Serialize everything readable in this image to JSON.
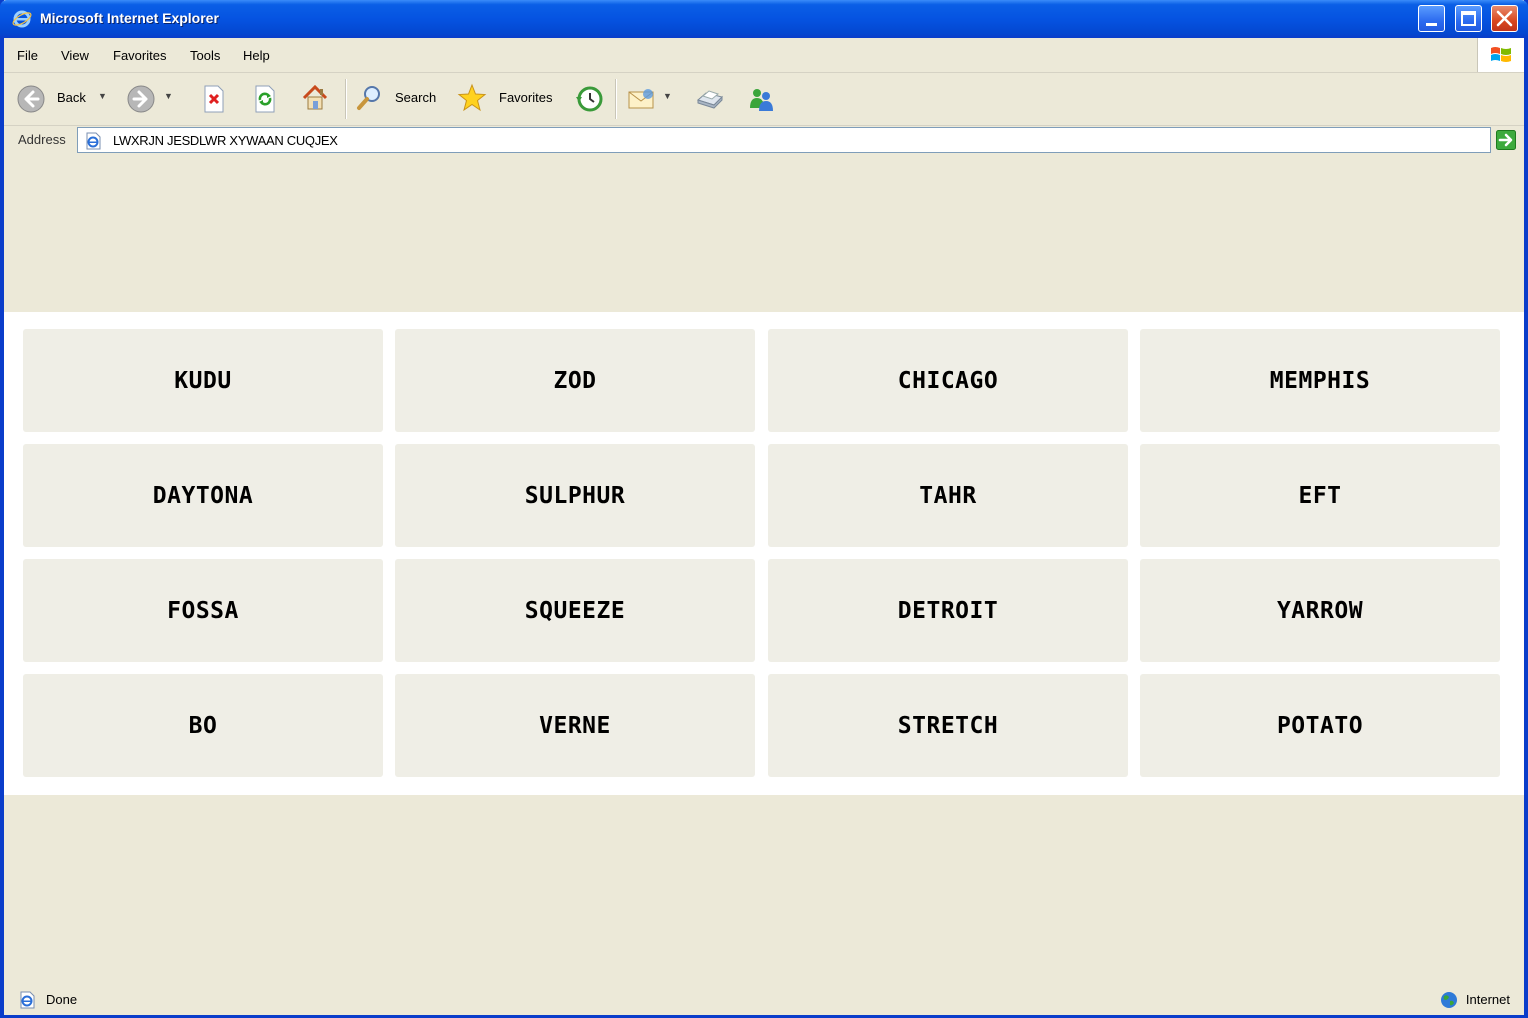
{
  "window": {
    "title": "Microsoft Internet Explorer"
  },
  "menu": {
    "items": [
      "File",
      "View",
      "Favorites",
      "Tools",
      "Help"
    ]
  },
  "toolbar": {
    "back_label": "Back",
    "search_label": "Search",
    "favorites_label": "Favorites"
  },
  "address": {
    "label": "Address",
    "value": "LWXRJN JESDLWR XYWAAN CUQJEX"
  },
  "grid": {
    "words": [
      "KUDU",
      "ZOD",
      "CHICAGO",
      "MEMPHIS",
      "DAYTONA",
      "SULPHUR",
      "TAHR",
      "EFT",
      "FOSSA",
      "SQUEEZE",
      "DETROIT",
      "YARROW",
      "BO",
      "VERNE",
      "STRETCH",
      "POTATO"
    ]
  },
  "status": {
    "text": "Done",
    "zone": "Internet"
  },
  "colors": {
    "titlebar": "#0553E1",
    "chrome": "#ECE9D8",
    "tile": "#EFEEE6",
    "panel": "#FFFFFF"
  }
}
